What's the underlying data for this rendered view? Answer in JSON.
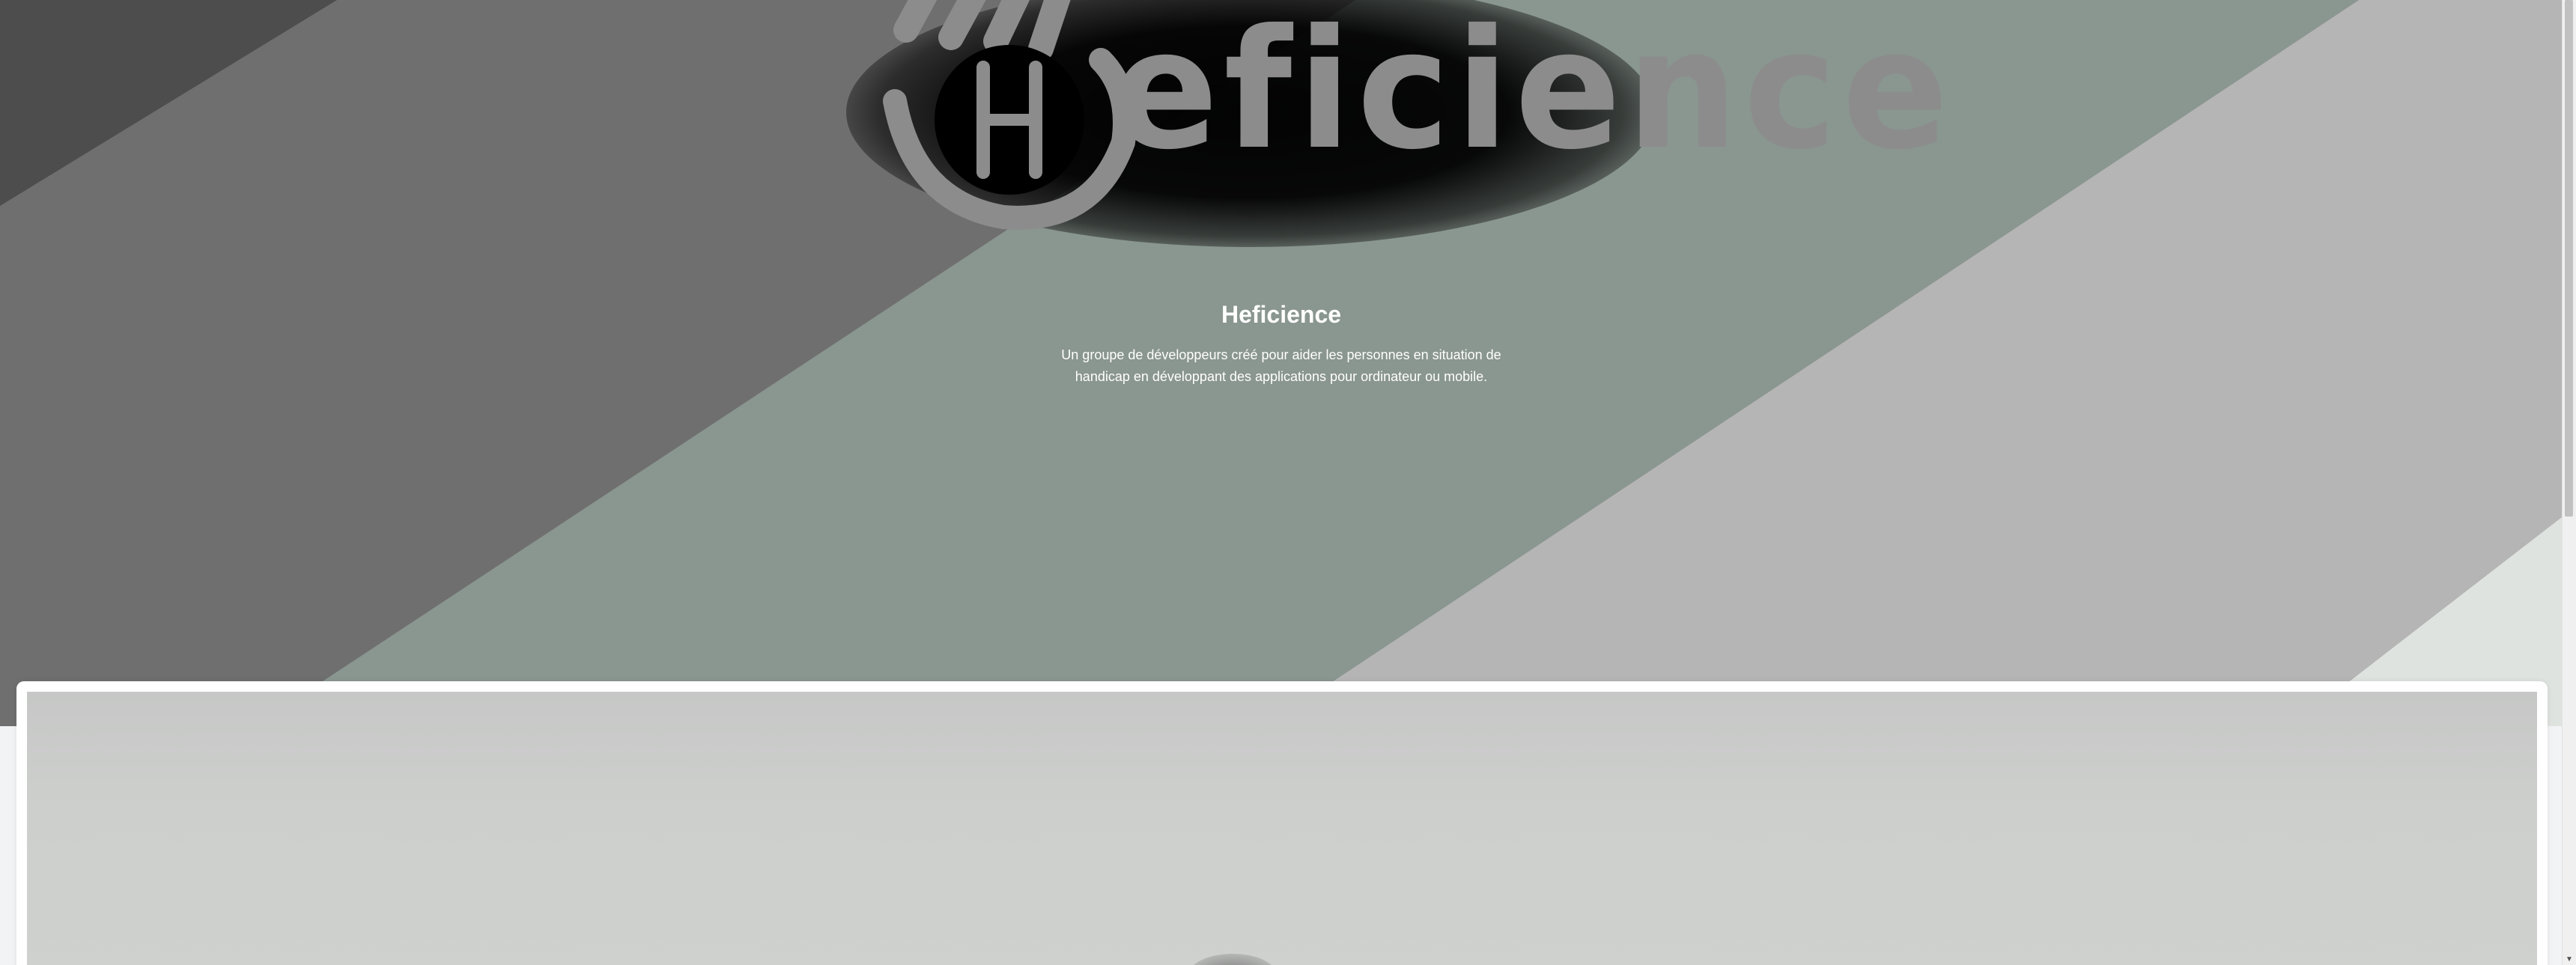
{
  "hero": {
    "logo_letter": "H",
    "logo_wordmark": "eficience",
    "title": "Heficience",
    "description": "Un groupe de développeurs créé pour aider les personnes en situation de handicap en développant des applications pour ordinateur ou mobile."
  },
  "icons": {
    "logo": "hand-h-logo-icon",
    "scroll_down": "scroll-down-arrow-icon"
  },
  "colors": {
    "stripe_dark": "#4d4d4d",
    "stripe_mid": "#6f6f6f",
    "stripe_green": "#8a9690",
    "stripe_light": "#b5b5b5",
    "stripe_pale": "#dfe3df",
    "logo_gray": "#8c8c8c"
  }
}
